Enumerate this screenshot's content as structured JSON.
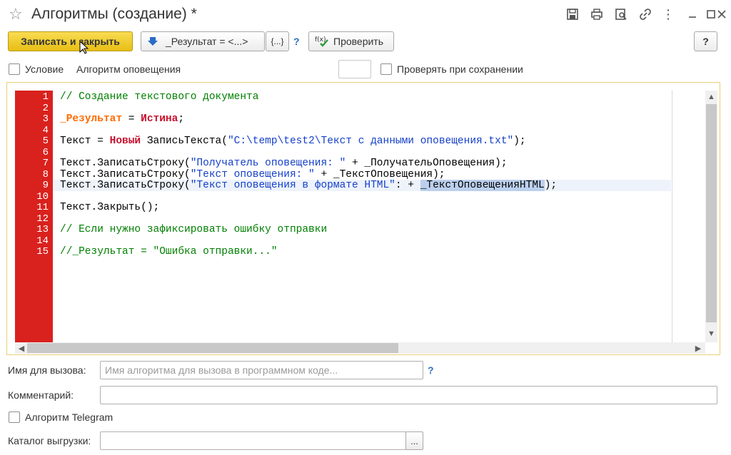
{
  "window": {
    "title": "Алгоритмы (создание) *",
    "toolbar_icons": [
      "save-icon",
      "print-icon",
      "preview-icon",
      "link-icon",
      "more-icon",
      "minimize-icon",
      "maximize-icon",
      "close-icon"
    ],
    "more_glyph": "⋮"
  },
  "toolbar": {
    "save_close_label": "Записать и закрыть",
    "result_label": "_Результат = <...>",
    "braces_label": "{...}",
    "help_q": "?",
    "check_label": "Проверить",
    "help_button_label": "?"
  },
  "options": {
    "condition_label": "Условие",
    "algorithm_label": "Алгоритм оповещения",
    "check_on_save_label": "Проверять при сохранении"
  },
  "editor": {
    "line_numbers": [
      "1",
      "2",
      "3",
      "4",
      "5",
      "6",
      "7",
      "8",
      "9",
      "10",
      "11",
      "12",
      "13",
      "14",
      "15"
    ],
    "current_line": 9
  },
  "form": {
    "call_name_label": "Имя для вызова:",
    "call_name_placeholder": "Имя алгоритма для вызова в программном коде...",
    "call_name_help": "?",
    "comment_label": "Комментарий:",
    "comment_value": "",
    "telegram_label": "Алгоритм Telegram",
    "export_dir_label": "Каталог выгрузки:",
    "export_dir_value": "",
    "browse_label": "..."
  },
  "colors": {
    "primary_button": "#f0cd2e",
    "gutter": "#d9211e",
    "frame_border": "#e7d07a"
  }
}
